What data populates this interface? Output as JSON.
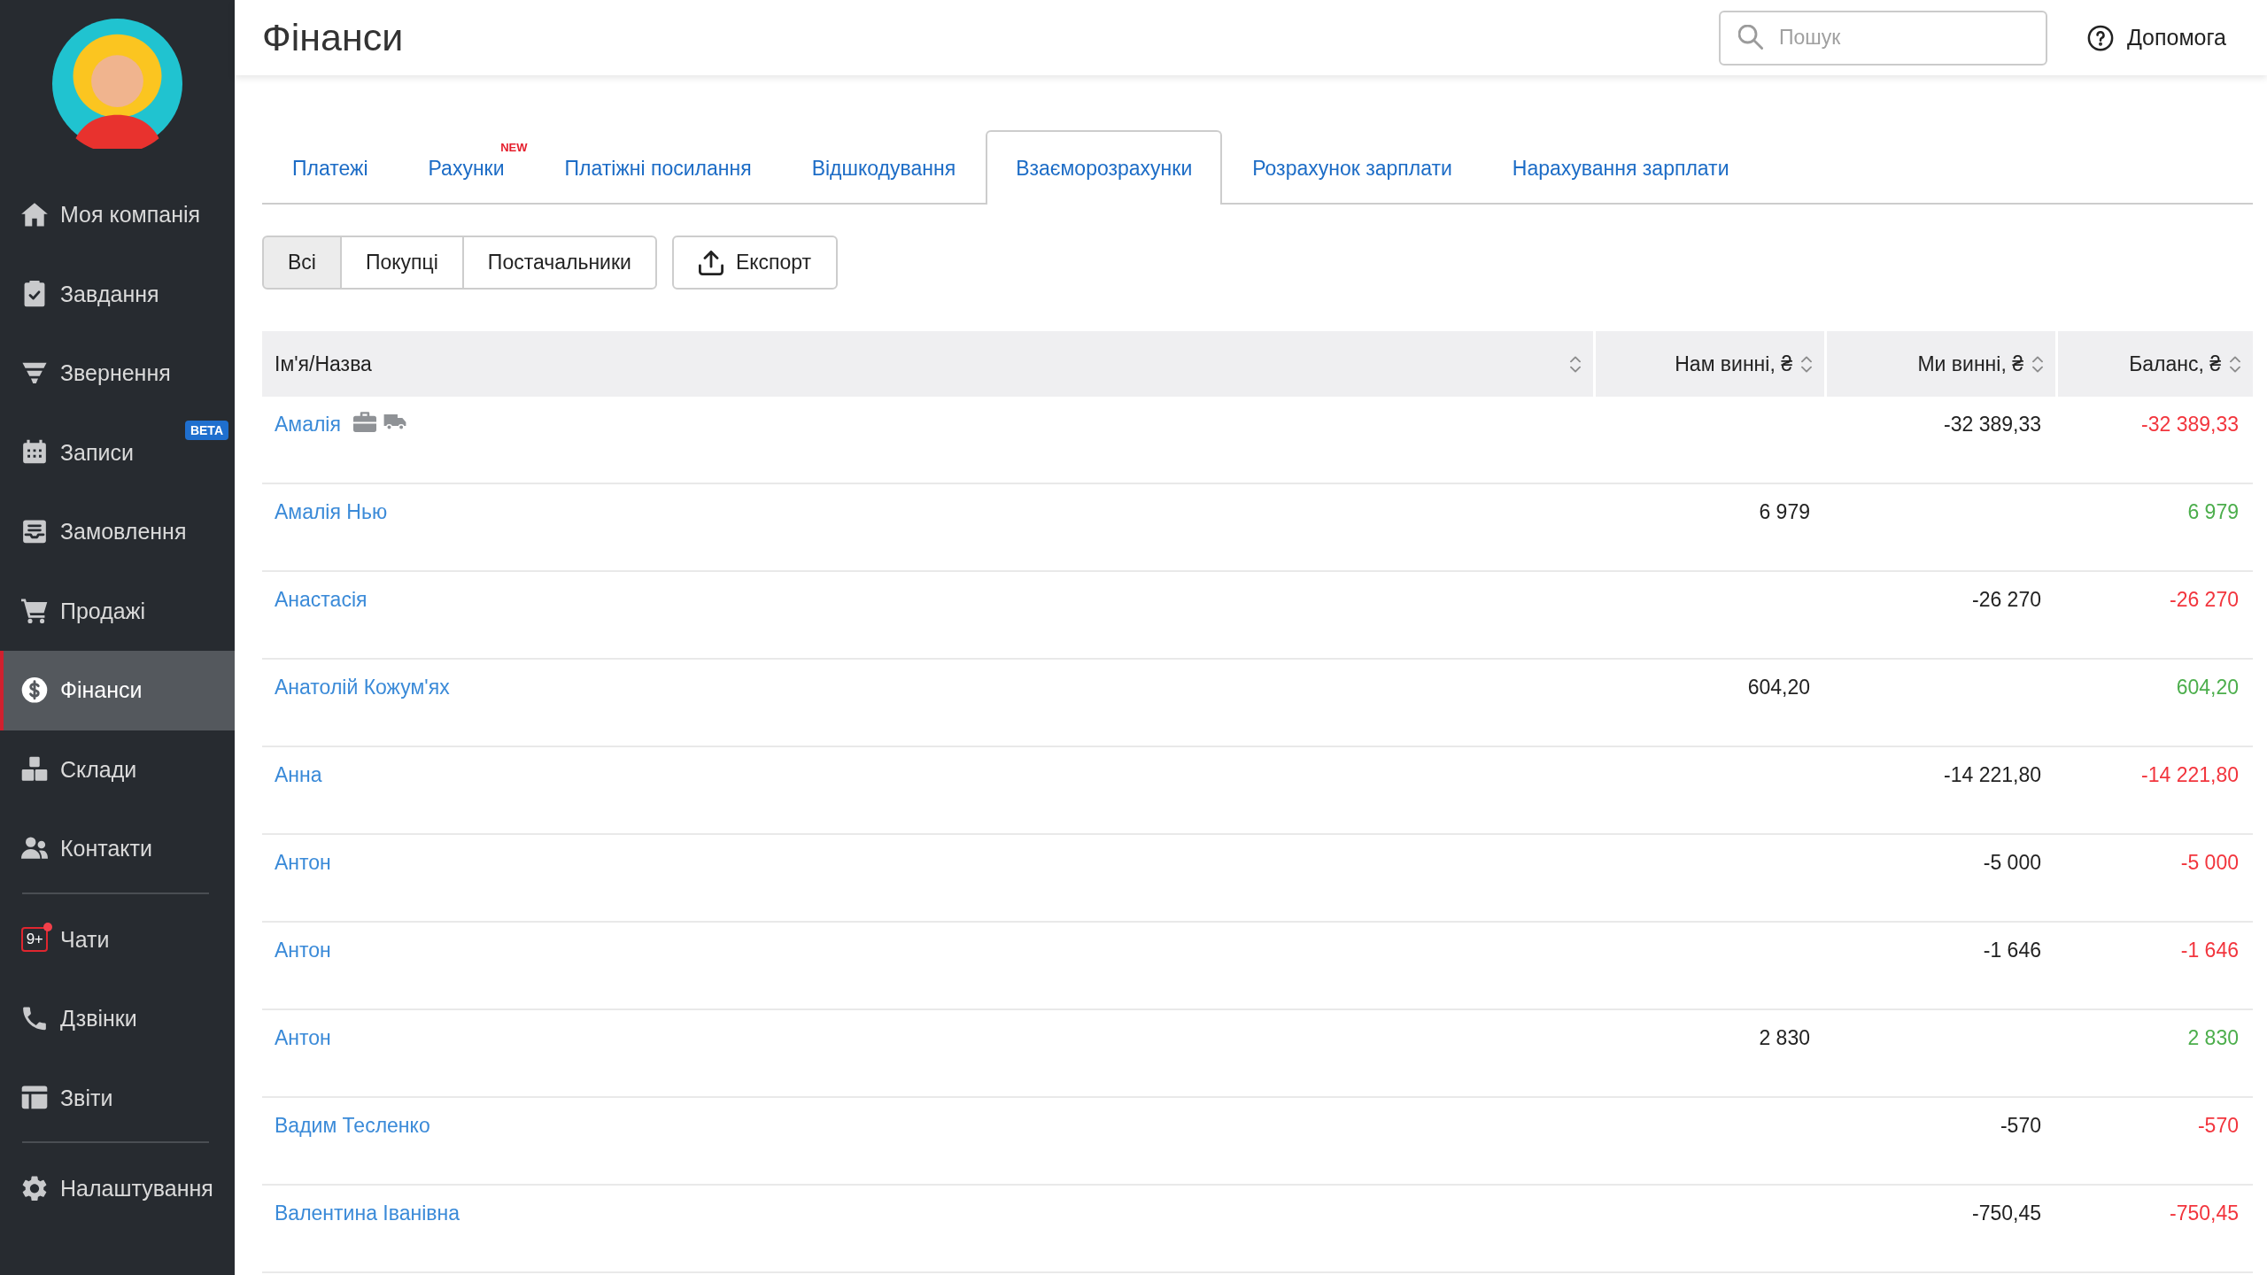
{
  "sidebar": {
    "groups": [
      {
        "items": [
          {
            "label": "Моя компанія",
            "selected": false,
            "unread": false
          },
          {
            "label": "Завдання",
            "selected": false,
            "unread": false
          },
          {
            "label": "Звернення",
            "selected": false,
            "unread": false
          },
          {
            "label": "Записи",
            "badge": "BETA",
            "selected": false,
            "unread": false
          },
          {
            "label": "Замовлення",
            "selected": false,
            "unread": false
          },
          {
            "label": "Продажі",
            "selected": false,
            "unread": false
          },
          {
            "label": "Фінанси",
            "selected": true,
            "unread": false
          },
          {
            "label": "Склади",
            "selected": false,
            "unread": false
          },
          {
            "label": "Контакти",
            "selected": false,
            "unread": false
          }
        ]
      },
      {
        "items": [
          {
            "label": "Чати",
            "counter": "9+",
            "selected": false,
            "unread": true
          },
          {
            "label": "Дзвінки",
            "selected": false,
            "unread": false
          },
          {
            "label": "Звіти",
            "selected": false,
            "unread": false
          }
        ]
      },
      {
        "items": [
          {
            "label": "Налаштування",
            "selected": false,
            "unread": false
          }
        ]
      }
    ]
  },
  "header": {
    "title": "Фінанси",
    "search": {
      "placeholder": "Пошук"
    },
    "help_link": "Допомога"
  },
  "tabs": [
    {
      "label": "Платежі",
      "selected": false
    },
    {
      "label": "Рахунки",
      "badge": "NEW",
      "selected": false
    },
    {
      "label": "Платіжні посилання",
      "selected": false
    },
    {
      "label": "Відшкодування",
      "selected": false
    },
    {
      "label": "Взаєморозрахунки",
      "selected": true
    },
    {
      "label": "Розрахунок зарплати",
      "selected": false
    },
    {
      "label": "Нарахування зарплати",
      "selected": false
    }
  ],
  "filters": [
    {
      "label": "Всі",
      "selected": true
    },
    {
      "label": "Покупці",
      "selected": false
    },
    {
      "label": "Постачальники",
      "selected": false
    }
  ],
  "export_button": "Експорт",
  "table": {
    "columns": [
      {
        "label": "Ім'я/Назва",
        "sortable": true
      },
      {
        "label": "Нам винні, ₴",
        "sortable": true
      },
      {
        "label": "Ми винні, ₴",
        "sortable": true
      },
      {
        "label": "Баланс, ₴",
        "sortable": true
      }
    ],
    "rows": [
      {
        "name": "Амалія",
        "role_icons": [
          {
            "kind": "customer"
          },
          {
            "kind": "supplier"
          }
        ],
        "we_owe": "-32 389,33",
        "balance": "-32 389,33",
        "color": "#f2353d"
      },
      {
        "name": "Амалія Нью",
        "owed_to_us": "6 979",
        "balance": "6 979",
        "color": "#4cae4c"
      },
      {
        "name": "Анастасія",
        "we_owe": "-26 270",
        "balance": "-26 270",
        "color": "#f2353d"
      },
      {
        "name": "Анатолій Кожум'ях",
        "owed_to_us": "604,20",
        "balance": "604,20",
        "color": "#4cae4c"
      },
      {
        "name": "Анна",
        "we_owe": "-14 221,80",
        "balance": "-14 221,80",
        "color": "#f2353d"
      },
      {
        "name": "Антон",
        "we_owe": "-5 000",
        "balance": "-5 000",
        "color": "#f2353d"
      },
      {
        "name": "Антон",
        "we_owe": "-1 646",
        "balance": "-1 646",
        "color": "#f2353d"
      },
      {
        "name": "Антон",
        "owed_to_us": "2 830",
        "balance": "2 830",
        "color": "#4cae4c"
      },
      {
        "name": "Вадим Тесленко",
        "we_owe": "-570",
        "balance": "-570",
        "color": "#f2353d"
      },
      {
        "name": "Валентина Іванівна",
        "we_owe": "-750,45",
        "balance": "-750,45",
        "color": "#f2353d"
      }
    ]
  }
}
